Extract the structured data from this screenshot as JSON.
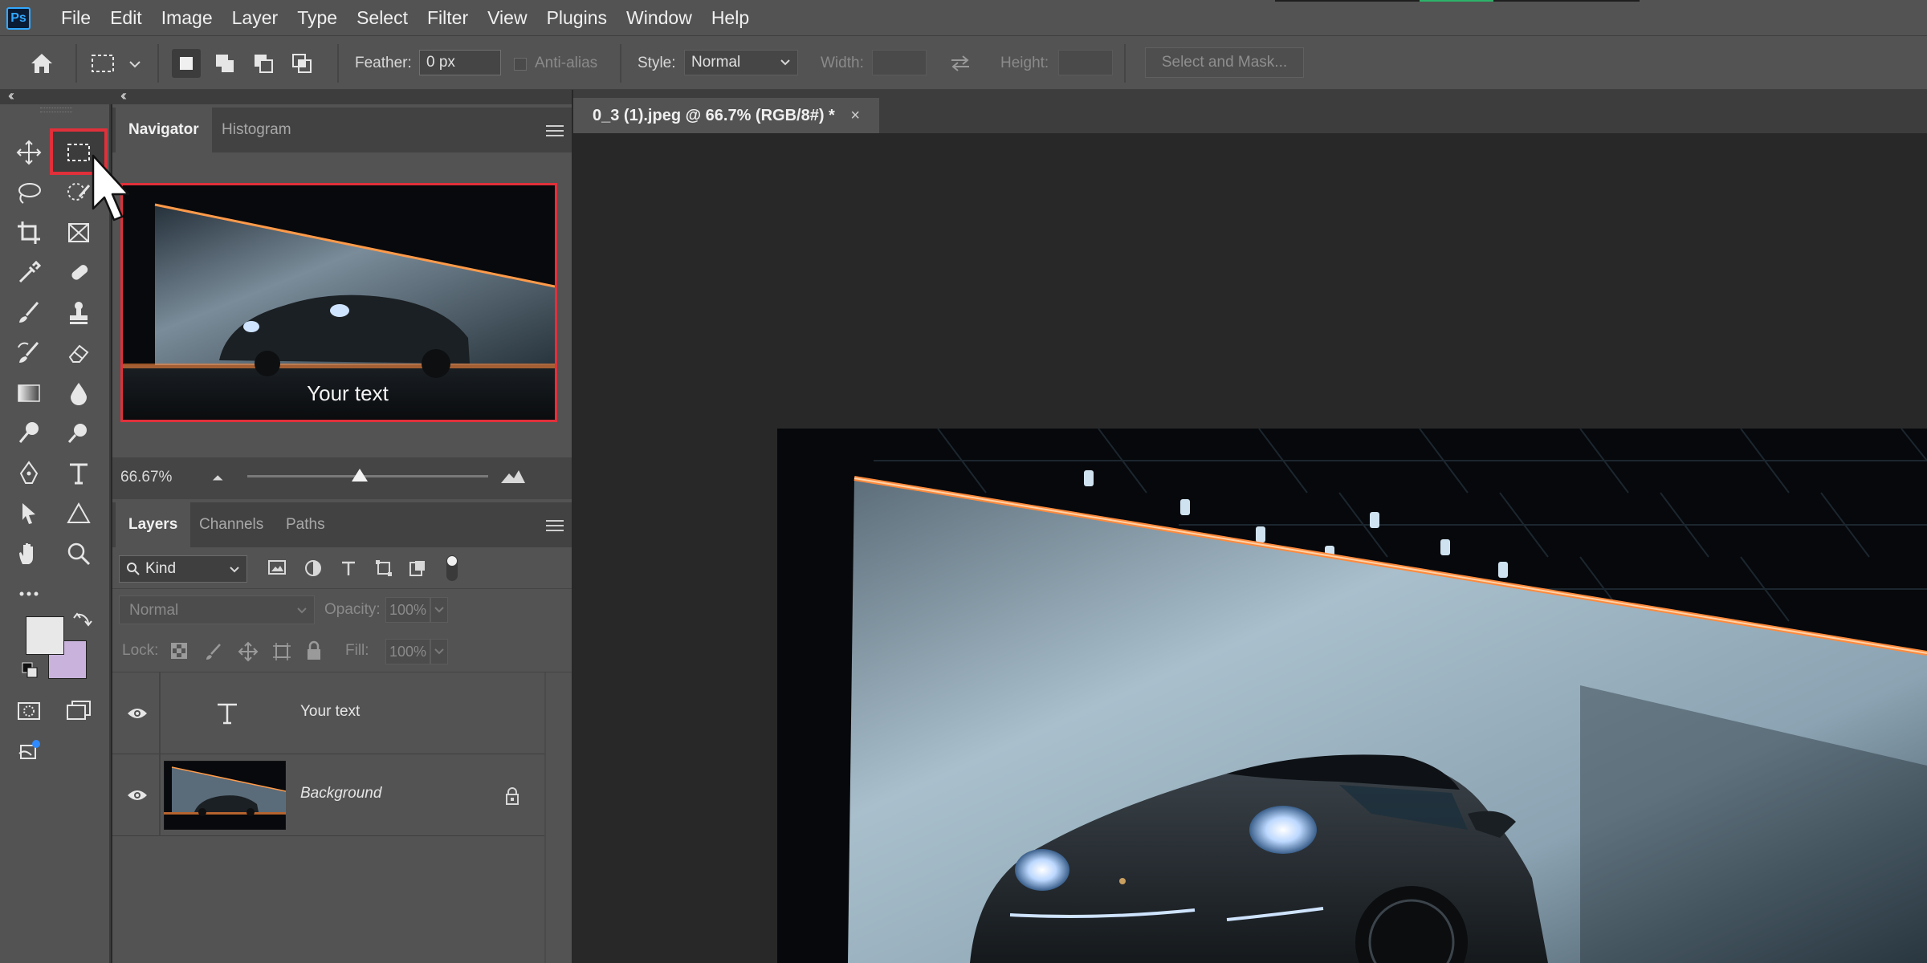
{
  "app": {
    "logo_text": "Ps"
  },
  "menu": [
    "File",
    "Edit",
    "Image",
    "Layer",
    "Type",
    "Select",
    "Filter",
    "View",
    "Plugins",
    "Window",
    "Help"
  ],
  "options_bar": {
    "feather_label": "Feather:",
    "feather_value": "0 px",
    "antialias_label": "Anti-alias",
    "style_label": "Style:",
    "style_value": "Normal",
    "width_label": "Width:",
    "height_label": "Height:",
    "select_mask_label": "Select and Mask..."
  },
  "navigator": {
    "tabs": [
      "Navigator",
      "Histogram"
    ],
    "active_tab": "Navigator",
    "zoom_value": "66.67%",
    "preview_overlay_text": "Your text"
  },
  "layers_panel": {
    "tabs": [
      "Layers",
      "Channels",
      "Paths"
    ],
    "active_tab": "Layers",
    "filter_kind": "Kind",
    "blend_mode": "Normal",
    "opacity_label": "Opacity:",
    "opacity_value": "100%",
    "lock_label": "Lock:",
    "fill_label": "Fill:",
    "fill_value": "100%",
    "layers": [
      {
        "name": "Your text",
        "type": "text",
        "visible": true
      },
      {
        "name": "Background",
        "type": "image",
        "visible": true,
        "locked": true
      }
    ]
  },
  "document": {
    "tab_title": "0_3 (1).jpeg @ 66.7% (RGB/8#) *",
    "close_glyph": "×"
  },
  "colors": {
    "foreground": "#e8e8e8",
    "background": "#c9b3dc",
    "highlight_box": "#e0303a",
    "accent_orange": "#ff8a3d"
  }
}
